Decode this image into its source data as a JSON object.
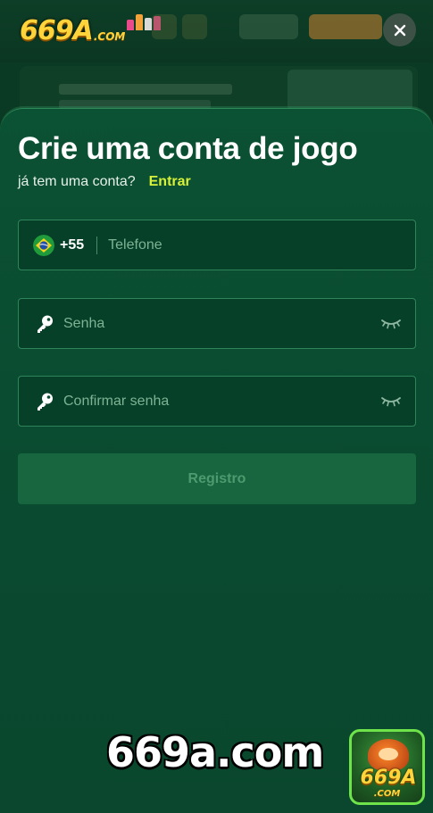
{
  "brand": {
    "logo_main": "669A",
    "logo_suffix": ".COM"
  },
  "modal": {
    "title": "Crie uma conta de jogo",
    "subtitle": "já tem uma conta?",
    "login_link": "Entrar",
    "phone": {
      "country_code": "+55",
      "placeholder": "Telefone",
      "flag_icon": "brazil-flag-icon"
    },
    "password": {
      "placeholder": "Senha",
      "icon": "key-icon",
      "toggle_icon": "eye-closed-icon"
    },
    "confirm_password": {
      "placeholder": "Confirmar senha",
      "icon": "key-icon",
      "toggle_icon": "eye-closed-icon"
    },
    "submit_label": "Registro"
  },
  "footer": {
    "url_text": "669a.com",
    "badge_main": "669A",
    "badge_suffix": ".COM"
  },
  "colors": {
    "accent_link": "#d7f03a",
    "sheet_bg": "#0b5133",
    "field_border": "#2f8559",
    "submit_bg": "#17663f",
    "logo_gold": "#ffd43a"
  }
}
